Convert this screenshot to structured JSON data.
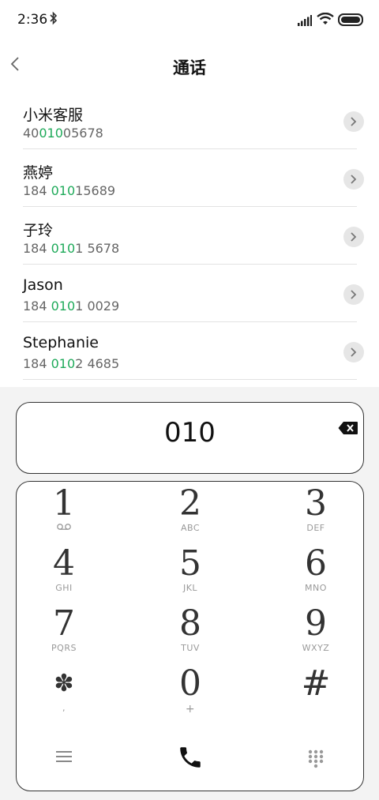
{
  "status": {
    "time": "2:36"
  },
  "header": {
    "title": "通话"
  },
  "contacts": [
    {
      "name": "小米客服",
      "num_pre": "40",
      "num_hl": "010",
      "num_post": "05678"
    },
    {
      "name": "燕婷",
      "num_pre": "184 ",
      "num_hl": "010",
      "num_post": "15689"
    },
    {
      "name": "子玲",
      "num_pre": "184 ",
      "num_hl": "010",
      "num_post": "1 5678"
    },
    {
      "name": "Jason",
      "num_pre": "184 ",
      "num_hl": "010",
      "num_post": "1 0029"
    },
    {
      "name": "Stephanie",
      "num_pre": "184 ",
      "num_hl": "010",
      "num_post": "2 4685"
    }
  ],
  "dialer": {
    "entered": "010",
    "keys": [
      {
        "digit": "1",
        "letters": ""
      },
      {
        "digit": "2",
        "letters": "ABC"
      },
      {
        "digit": "3",
        "letters": "DEF"
      },
      {
        "digit": "4",
        "letters": "GHI"
      },
      {
        "digit": "5",
        "letters": "JKL"
      },
      {
        "digit": "6",
        "letters": "MNO"
      },
      {
        "digit": "7",
        "letters": "PQRS"
      },
      {
        "digit": "8",
        "letters": "TUV"
      },
      {
        "digit": "9",
        "letters": "WXYZ"
      },
      {
        "digit": "✽",
        "letters": ","
      },
      {
        "digit": "0",
        "letters": "+"
      },
      {
        "digit": "#",
        "letters": ""
      }
    ]
  },
  "icons": {
    "status": [
      "bluetooth-icon",
      "signal-icon",
      "wifi-icon",
      "battery-icon"
    ],
    "header": "back-chevron-icon",
    "row": "chevron-right-icon",
    "display": "backspace-icon",
    "key1": "voicemail-icon",
    "bottom": [
      "menu-icon",
      "phone-call-icon",
      "dialpad-icon"
    ]
  },
  "colors": {
    "highlight": "#1faa5a",
    "background": "#f3f3f3"
  }
}
